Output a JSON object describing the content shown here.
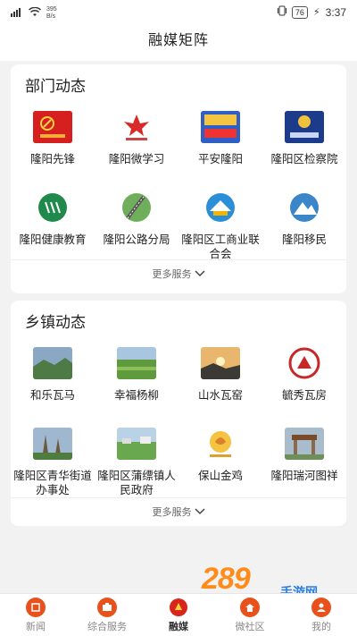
{
  "status_bar": {
    "speed": "395\nB/s",
    "battery": "76",
    "time": "3:37"
  },
  "header": {
    "title": "融媒矩阵"
  },
  "department": {
    "title": "部门动态",
    "more": "更多服务",
    "items": [
      {
        "label": "隆阳先锋",
        "icon": "party-flag-icon"
      },
      {
        "label": "隆阳微学习",
        "icon": "study-logo-icon"
      },
      {
        "label": "平安隆阳",
        "icon": "safety-banner-icon"
      },
      {
        "label": "隆阳区检察院",
        "icon": "procuratorate-icon"
      },
      {
        "label": "隆阳健康教育",
        "icon": "health-education-icon"
      },
      {
        "label": "隆阳公路分局",
        "icon": "highway-icon"
      },
      {
        "label": "隆阳区工商业联合会",
        "icon": "commerce-federation-icon"
      },
      {
        "label": "隆阳移民",
        "icon": "migration-icon"
      }
    ]
  },
  "towns": {
    "title": "乡镇动态",
    "more": "更多服务",
    "items": [
      {
        "label": "和乐瓦马",
        "icon": "landscape-photo-icon"
      },
      {
        "label": "幸福杨柳",
        "icon": "fields-photo-icon"
      },
      {
        "label": "山水瓦窑",
        "icon": "sunset-photo-icon"
      },
      {
        "label": "毓秀瓦房",
        "icon": "town-emblem-icon"
      },
      {
        "label": "隆阳区青华街道办事处",
        "icon": "village-photo-icon"
      },
      {
        "label": "隆阳区蒲缥镇人民政府",
        "icon": "farmland-photo-icon"
      },
      {
        "label": "保山金鸡",
        "icon": "golden-rooster-icon"
      },
      {
        "label": "隆阳瑞河图祥",
        "icon": "gate-photo-icon"
      }
    ]
  },
  "bottom_nav": {
    "items": [
      {
        "label": "新闻",
        "icon": "news-icon",
        "active": false
      },
      {
        "label": "综合服务",
        "icon": "services-icon",
        "active": false
      },
      {
        "label": "融媒",
        "icon": "media-icon",
        "active": true
      },
      {
        "label": "微社区",
        "icon": "community-icon",
        "active": false
      },
      {
        "label": "我的",
        "icon": "profile-icon",
        "active": false
      }
    ]
  },
  "watermark": {
    "text": "289",
    "sub": "手游网"
  },
  "colors": {
    "accent": "#e8511c",
    "background": "#f2f2f2"
  }
}
